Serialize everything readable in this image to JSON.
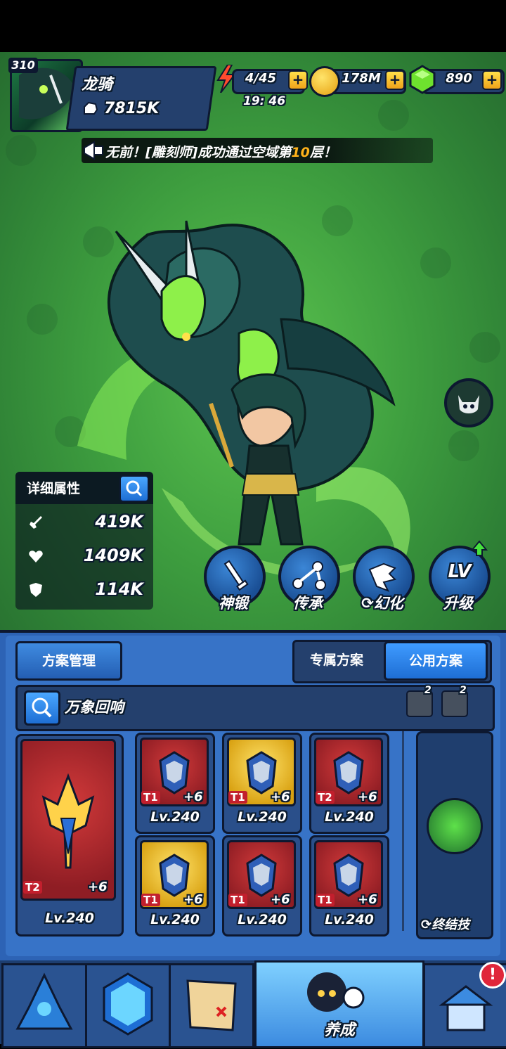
{
  "player": {
    "level": "310",
    "name": "龙骑",
    "power": "7815K"
  },
  "resources": {
    "energy": "4/45",
    "energy_timer": "19: 46",
    "gold": "178M",
    "gems": "890",
    "plus": "+"
  },
  "announcement": {
    "prefix": "无前！[雕刻师]成功通过空域第",
    "highlight": "10",
    "suffix": "层！"
  },
  "details": {
    "title": "详细属性",
    "attack": "419K",
    "health": "1409K",
    "defense": "114K"
  },
  "actions": {
    "forge": "神锻",
    "inherit": "传承",
    "illusion": "幻化",
    "upgrade": "升级",
    "upgrade_icon_text": "LV"
  },
  "plan": {
    "manage_label": "方案管理",
    "exclusive_label": "专属方案",
    "public_label": "公用方案",
    "set_name": "万象回响",
    "badge1_count": "2",
    "badge2_count": "2"
  },
  "equipment": {
    "main": {
      "tier": "T2",
      "plus": "+6",
      "level": "Lv.240"
    },
    "items": [
      {
        "tier": "T1",
        "plus": "+6",
        "level": "Lv.240",
        "rarity": "red"
      },
      {
        "tier": "T1",
        "plus": "+6",
        "level": "Lv.240",
        "rarity": "gold"
      },
      {
        "tier": "T2",
        "plus": "+6",
        "level": "Lv.240",
        "rarity": "red"
      },
      {
        "tier": "T1",
        "plus": "+6",
        "level": "Lv.240",
        "rarity": "gold"
      },
      {
        "tier": "T1",
        "plus": "+6",
        "level": "Lv.240",
        "rarity": "red"
      },
      {
        "tier": "T1",
        "plus": "+6",
        "level": "Lv.240",
        "rarity": "red"
      }
    ],
    "ultimate_label": "终结技"
  },
  "nav": {
    "active_label": "养成",
    "alert": "!"
  },
  "colors": {
    "scene_green": "#3e9e3f",
    "panel_blue": "#3773c7",
    "outline": "#0d1830",
    "gold_text": "#ffb21a"
  }
}
